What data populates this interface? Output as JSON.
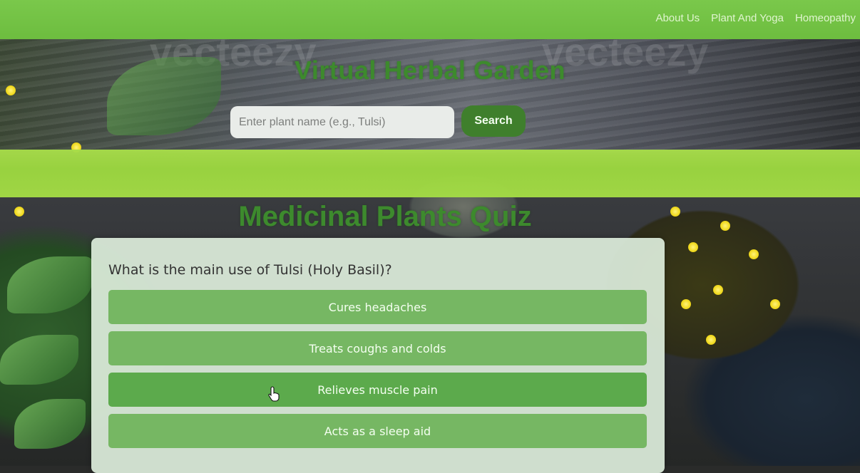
{
  "nav": {
    "links": [
      "About Us",
      "Plant And Yoga",
      "Homeopathy"
    ]
  },
  "header": {
    "title": "Virtual Herbal Garden"
  },
  "search": {
    "placeholder": "Enter plant name (e.g., Tulsi)",
    "button_label": "Search"
  },
  "quiz": {
    "title": "Medicinal Plants Quiz",
    "question": "What is the main use of Tulsi (Holy Basil)?",
    "options": [
      "Cures headaches",
      "Treats coughs and colds",
      "Relieves muscle pain",
      "Acts as a sleep aid"
    ],
    "hovered_option_index": 2
  },
  "colors": {
    "navbar": "#6dbd3f",
    "accent_green": "#3d8a2d",
    "option_green": "#76b763",
    "band_lime": "#a4dc45"
  },
  "icons": {
    "cursor": "hand-pointer-icon"
  }
}
